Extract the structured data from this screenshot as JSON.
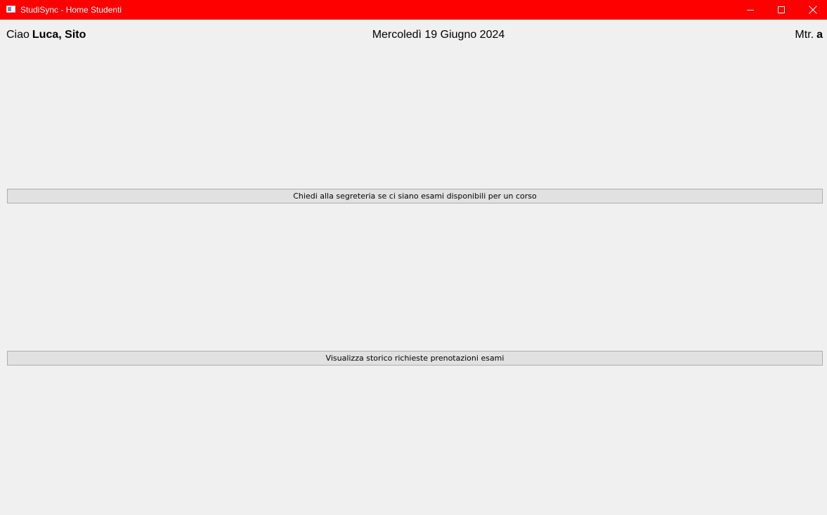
{
  "window": {
    "title": "StudiSync - Home Studenti",
    "titlebar_color": "#ff0000",
    "controls": {
      "minimize_icon": "minimize-icon",
      "maximize_icon": "maximize-icon",
      "close_icon": "close-icon"
    }
  },
  "header": {
    "greeting_prefix": "Ciao",
    "user_name": "Luca, Sito",
    "date": "Mercoledì 19 Giugno 2024",
    "matricola_label": "Mtr.",
    "matricola_value": "a"
  },
  "actions": {
    "ask_exams_label": "Chiedi alla segreteria se ci siano esami disponibili per un corso",
    "history_label": "Visualizza storico richieste prenotazioni esami"
  }
}
